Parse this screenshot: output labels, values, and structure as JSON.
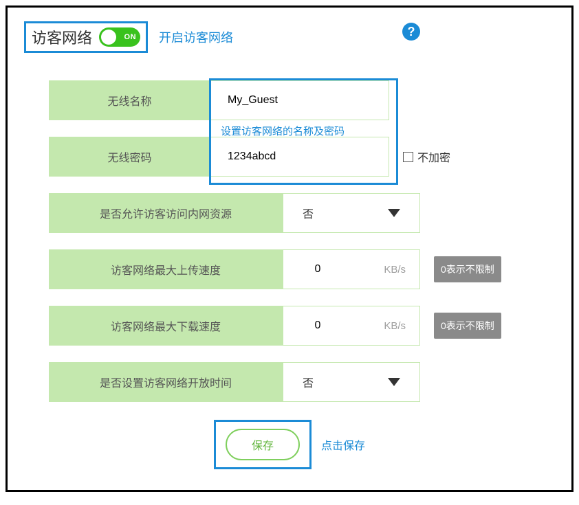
{
  "header": {
    "title": "访客网络",
    "toggle_state": "ON",
    "toggle_hint": "开启访客网络",
    "help_icon": "?"
  },
  "annotations": {
    "name_pwd_hint": "设置访客网络的名称及密码",
    "save_hint": "点击保存"
  },
  "fields": {
    "ssid": {
      "label": "无线名称",
      "value": "My_Guest"
    },
    "password": {
      "label": "无线密码",
      "value": "1234abcd",
      "no_encrypt_label": "不加密",
      "no_encrypt_checked": false
    },
    "allow_lan": {
      "label": "是否允许访客访问内网资源",
      "value": "否"
    },
    "upload": {
      "label": "访客网络最大上传速度",
      "value": "0",
      "unit": "KB/s",
      "badge": "0表示不限制"
    },
    "download": {
      "label": "访客网络最大下载速度",
      "value": "0",
      "unit": "KB/s",
      "badge": "0表示不限制"
    },
    "schedule": {
      "label": "是否设置访客网络开放时间",
      "value": "否"
    }
  },
  "actions": {
    "save": "保存"
  },
  "colors": {
    "accent_blue": "#1b8bd6",
    "green_bg": "#c4e8ae",
    "toggle_green": "#39c21d",
    "badge_grey": "#8a8a8a"
  }
}
